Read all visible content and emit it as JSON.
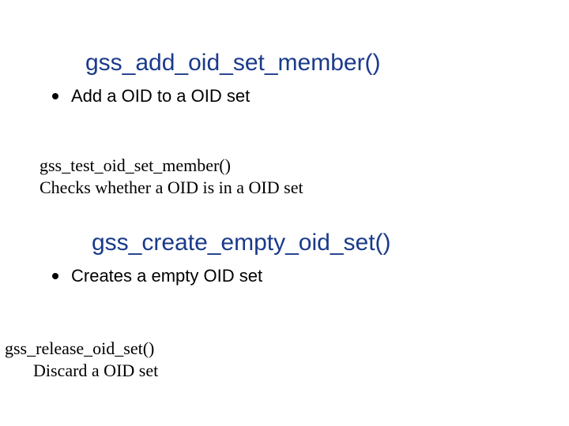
{
  "sections": [
    {
      "heading": "gss_add_oid_set_member()",
      "bullet": "Add a OID to a OID set"
    },
    {
      "plain_heading": "gss_test_oid_set_member()",
      "plain_body": "Checks whether a OID is in a OID set"
    },
    {
      "heading": "gss_create_empty_oid_set()",
      "bullet": "Creates a empty OID set"
    },
    {
      "plain_heading": "gss_release_oid_set()",
      "plain_body": "Discard a OID set"
    }
  ]
}
